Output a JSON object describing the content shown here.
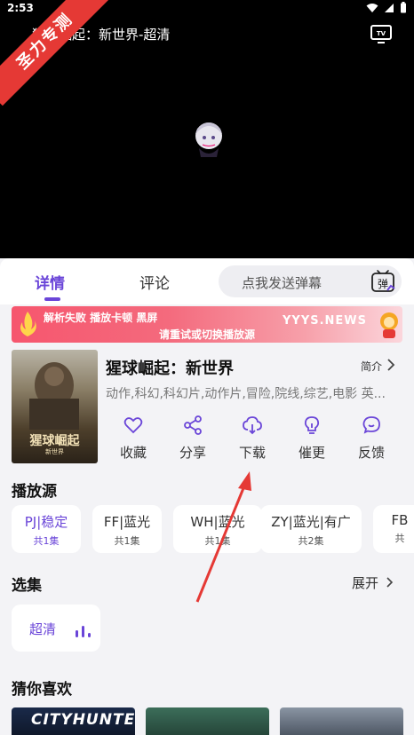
{
  "status": {
    "time": "2:53"
  },
  "player": {
    "title": "猩球崛起：新世界-超清",
    "watermark": "圣力专测"
  },
  "tabs": {
    "detail": "详情",
    "comment": "评论"
  },
  "danmu": {
    "placeholder": "点我发送弹幕",
    "button": "弹"
  },
  "banner": {
    "line1": "解析失败  播放卡顿  黑屏",
    "line2": "请重试或切换播放源",
    "site": "YYYS.NEWS"
  },
  "movie": {
    "title": "猩球崛起：新世界",
    "intro_label": "简介",
    "genres": "动作,科幻,科幻片,动作片,冒险,院线,综艺,电影 英...",
    "poster_title": "猩球崛起",
    "poster_subtitle": "新世界"
  },
  "actions": [
    {
      "label": "收藏",
      "icon": "heart-icon"
    },
    {
      "label": "分享",
      "icon": "share-icon"
    },
    {
      "label": "下载",
      "icon": "download-icon"
    },
    {
      "label": "催更",
      "icon": "bulb-icon"
    },
    {
      "label": "反馈",
      "icon": "feedback-icon"
    }
  ],
  "sources": {
    "title": "播放源",
    "items": [
      {
        "name": "PJ|稳定",
        "count": "共1集",
        "active": true
      },
      {
        "name": "FF|蓝光",
        "count": "共1集"
      },
      {
        "name": "WH|蓝光",
        "count": "共1集"
      },
      {
        "name": "ZY|蓝光|有广",
        "count": "共2集"
      },
      {
        "name": "FB",
        "count": "共"
      }
    ]
  },
  "episodes": {
    "title": "选集",
    "expand": "展开",
    "items": [
      {
        "label": "超清"
      }
    ]
  },
  "recommend": {
    "title": "猜你喜欢",
    "items": [
      {
        "label": "CITYHUNTER"
      },
      {
        "label": ""
      },
      {
        "label": ""
      }
    ]
  },
  "colors": {
    "accent": "#6a45d8",
    "banner": "#f6566e",
    "ribbon": "#e53935"
  }
}
